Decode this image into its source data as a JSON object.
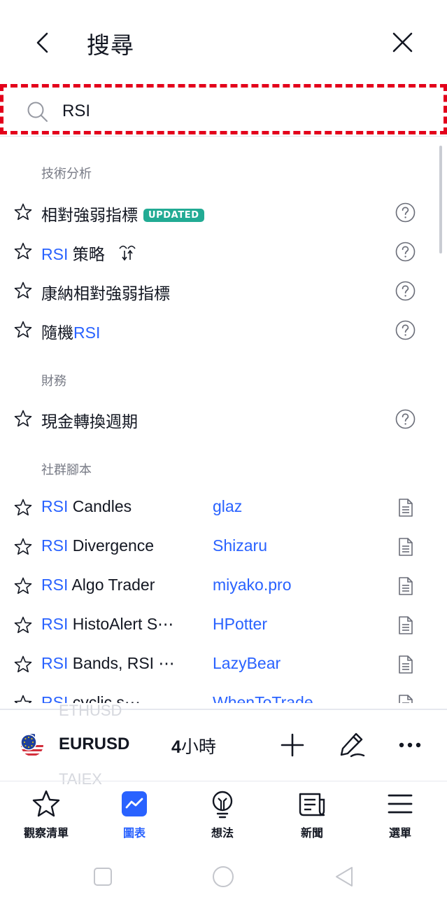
{
  "header": {
    "title": "搜尋"
  },
  "search": {
    "value": "RSI",
    "highlight_color": "#e3001b"
  },
  "sections": {
    "technical": {
      "title": "技術分析",
      "items": [
        {
          "highlight": "",
          "text": "相對強弱指標",
          "badge": "UPDATED"
        },
        {
          "highlight": "RSI",
          "text": " 策略"
        },
        {
          "highlight": "",
          "text": "康納相對強弱指標"
        },
        {
          "text": "隨機",
          "highlight": "RSI"
        }
      ]
    },
    "financial": {
      "title": "財務",
      "items": [
        {
          "highlight": "",
          "text": "現金轉換週期"
        }
      ]
    },
    "community": {
      "title": "社群腳本",
      "items": [
        {
          "highlight": "RSI",
          "text": " Candles",
          "author": "glaz"
        },
        {
          "highlight": "RSI",
          "text": " Divergence",
          "author": "Shizaru"
        },
        {
          "highlight": "RSI",
          "text": " Algo Trader",
          "author": "miyako.pro"
        },
        {
          "highlight": "RSI",
          "text": " HistoAlert S⋯",
          "author": "HPotter"
        },
        {
          "highlight": "RSI",
          "text": " Bands, RSI ⋯",
          "author": "LazyBear"
        },
        {
          "highlight": "RSI",
          "text": " cyclic s⋯",
          "author": "WhenToTrade"
        }
      ]
    }
  },
  "symbol_bar": {
    "symbol": "EURUSD",
    "interval_number": "4",
    "interval_unit": "小時",
    "ghost_top": "ETHUSD",
    "ghost_bottom": "TAIEX"
  },
  "bottom_nav": {
    "items": [
      {
        "label": "觀察清單",
        "icon": "star-icon"
      },
      {
        "label": "圖表",
        "icon": "chart-icon",
        "active": true
      },
      {
        "label": "想法",
        "icon": "lightbulb-icon"
      },
      {
        "label": "新聞",
        "icon": "news-icon"
      },
      {
        "label": "選單",
        "icon": "menu-icon"
      }
    ]
  },
  "colors": {
    "accent": "#2962ff",
    "badge": "#22ab94",
    "muted": "#787b86",
    "text": "#131722"
  }
}
